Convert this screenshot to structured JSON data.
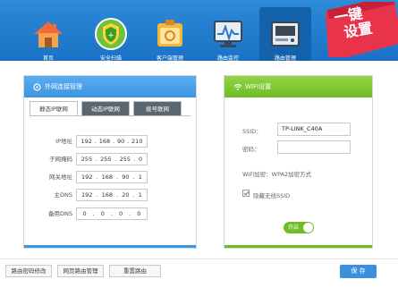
{
  "nav": {
    "items": [
      {
        "label": "首页",
        "icon": "home-icon"
      },
      {
        "label": "安全扫描",
        "icon": "shield-icon"
      },
      {
        "label": "客户端管理",
        "icon": "client-icon"
      },
      {
        "label": "路由监控",
        "icon": "monitor-icon"
      },
      {
        "label": "路由管理",
        "icon": "router-icon"
      }
    ]
  },
  "ribbon": {
    "line1": "一键",
    "line2": "设置",
    "color": "#e8334a"
  },
  "wan_panel": {
    "title": "外网连接管理",
    "tabs": [
      "静态IP联网",
      "动态IP联网",
      "拨号联网"
    ],
    "fields": [
      {
        "label": "IP地址",
        "octets": [
          "192",
          "168",
          "90",
          "210"
        ]
      },
      {
        "label": "子网掩码",
        "octets": [
          "255",
          "255",
          "255",
          "0"
        ]
      },
      {
        "label": "网关地址",
        "octets": [
          "192",
          "168",
          "90",
          "1"
        ]
      },
      {
        "label": "主DNS",
        "octets": [
          "192",
          "168",
          "20",
          "1"
        ]
      },
      {
        "label": "备用DNS",
        "octets": [
          "0",
          "0",
          "0",
          "0"
        ]
      }
    ]
  },
  "wifi_panel": {
    "title": "WIFI设置",
    "ssid_label": "SSID：",
    "ssid_value": "TP-LINK_C40A",
    "password_label": "密码：",
    "password_value": "",
    "encryption": "WiFi加密：WPA2加密方式",
    "hide_ssid_label": "隐藏无线SSID",
    "toggle_label": "开启"
  },
  "footer": {
    "buttons": [
      "路由密码修改",
      "网页路由管理",
      "重置路由"
    ],
    "save_label": "保 存"
  },
  "colors": {
    "topbar": "#1a72c4",
    "wan_accent": "#3e95e0",
    "wifi_accent": "#6fbc27",
    "save": "#3b8fde"
  }
}
